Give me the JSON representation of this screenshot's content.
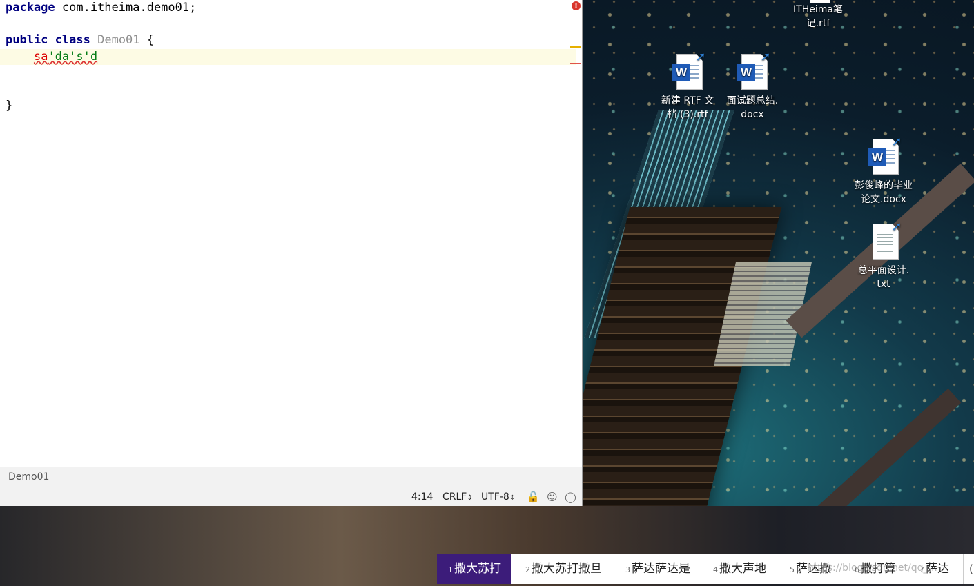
{
  "editor": {
    "lines": {
      "package_kw": "package",
      "package_name": " com.itheima.demo01;",
      "public_kw": "public",
      "class_kw": "class",
      "class_name": "Demo01",
      "open_brace": "{",
      "bad_code_red": "sa",
      "bad_code_green": "'da's'd",
      "close_brace": "}"
    },
    "error_indicator": "!"
  },
  "breadcrumb": {
    "label": "Demo01"
  },
  "statusbar": {
    "position": "4:14",
    "line_separator": "CRLF",
    "encoding": "UTF-8"
  },
  "icons": {
    "lock": "lock-icon",
    "inspector": "inspector-icon",
    "notifications": "notifications-icon"
  },
  "desktop": {
    "icons": [
      {
        "label": "ITHeima笔\n记.rtf",
        "type": "rtf"
      },
      {
        "label": "新建 RTF 文\n档 (3).rtf",
        "type": "word"
      },
      {
        "label": "面试题总结.\ndocx",
        "type": "word"
      },
      {
        "label": "彭俊峰的毕业\n论文.docx",
        "type": "word"
      },
      {
        "label": "总平面设计.\ntxt",
        "type": "txt"
      }
    ]
  },
  "ime": {
    "candidates": [
      {
        "num": "1",
        "text": "撒大苏打"
      },
      {
        "num": "2",
        "text": "撒大苏打撒旦"
      },
      {
        "num": "3",
        "text": "萨达萨达是"
      },
      {
        "num": "4",
        "text": "撒大声地"
      },
      {
        "num": "5",
        "text": "萨达撒"
      },
      {
        "num": "6",
        "text": "撒打算"
      },
      {
        "num": "7",
        "text": "萨达"
      }
    ],
    "more": "(",
    "selected_color": "#3c1c7a"
  },
  "watermark": "https://blog.csdn.net/qq_..."
}
